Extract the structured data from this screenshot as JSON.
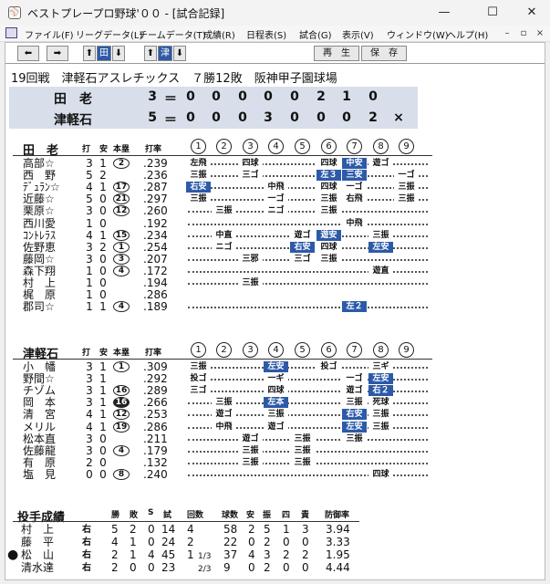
{
  "window": {
    "title": "ベストプレープロ野球'００ - [試合記録]",
    "app_icon": "⚾",
    "min": "—",
    "max": "☐",
    "close": "✕"
  },
  "menu": [
    "ファイル(F)",
    "リーグデータ(L)",
    "チームデータ(T)",
    "成績(R)",
    "日程表(S)",
    "試合(G)",
    "表示(V)",
    "ウィンドウ(W)",
    "ヘルプ(H)"
  ],
  "mdi_controls": [
    "–",
    "▫",
    "×"
  ],
  "toolbar": {
    "prev": "⬅",
    "next": "➡",
    "up": "⬆",
    "team1": "田",
    "down": "⬇",
    "team2": "津",
    "replay": "再　生",
    "save": "保　存"
  },
  "game_info": "19回戦　津軽石アスレチックス　７勝12敗　阪神甲子園球場",
  "linescore": [
    {
      "team": "田　老",
      "total": "3",
      "eq": "＝",
      "innings": [
        "0",
        "0",
        "0",
        "0",
        "0",
        "2",
        "1",
        "0",
        ""
      ]
    },
    {
      "team": "津軽石",
      "total": "5",
      "eq": "＝",
      "innings": [
        "0",
        "0",
        "0",
        "3",
        "0",
        "0",
        "0",
        "2",
        "×"
      ]
    }
  ],
  "inning_labels": [
    "1",
    "2",
    "3",
    "4",
    "5",
    "6",
    "7",
    "8",
    "9"
  ],
  "headers": {
    "ab": "打",
    "h": "安",
    "hr": "本塁",
    "avg": "打率"
  },
  "team1": {
    "name": "田　老",
    "players": [
      {
        "name": "高部☆",
        "ab": "3",
        "h": "1",
        "hr": "2",
        "hr_filled": false,
        "avg": ".239",
        "pa": [
          {
            "i": 1,
            "t": "左飛"
          },
          {
            "i": 3,
            "t": "四球"
          },
          {
            "i": 6,
            "t": "四球"
          },
          {
            "i": 7,
            "t": "中安",
            "hit": true
          },
          {
            "i": 8,
            "t": "遊ゴ"
          }
        ]
      },
      {
        "name": "西　野",
        "ab": "5",
        "h": "2",
        "hr": "",
        "avg": ".236",
        "pa": [
          {
            "i": 1,
            "t": "三振"
          },
          {
            "i": 3,
            "t": "三ゴ"
          },
          {
            "i": 6,
            "t": "左３",
            "hit": true
          },
          {
            "i": 7,
            "t": "三安",
            "hit": true
          },
          {
            "i": 9,
            "t": "一ゴ"
          }
        ]
      },
      {
        "name": "ﾃﾞｭﾗﾝ☆",
        "ab": "4",
        "h": "1",
        "hr": "17",
        "hr_filled": false,
        "avg": ".287",
        "pa": [
          {
            "i": 1,
            "t": "右安",
            "hit": true
          },
          {
            "i": 4,
            "t": "中飛"
          },
          {
            "i": 6,
            "t": "四球"
          },
          {
            "i": 7,
            "t": "一ゴ"
          },
          {
            "i": 9,
            "t": "三振"
          }
        ]
      },
      {
        "name": "近藤☆",
        "ab": "5",
        "h": "0",
        "hr": "21",
        "hr_filled": false,
        "avg": ".297",
        "pa": [
          {
            "i": 1,
            "t": "三振"
          },
          {
            "i": 4,
            "t": "一ゴ"
          },
          {
            "i": 6,
            "t": "三振"
          },
          {
            "i": 7,
            "t": "右飛"
          },
          {
            "i": 9,
            "t": "三振"
          }
        ]
      },
      {
        "name": "栗原☆",
        "ab": "3",
        "h": "0",
        "hr": "12",
        "hr_filled": false,
        "avg": ".260",
        "pa": [
          {
            "i": 2,
            "t": "三振"
          },
          {
            "i": 4,
            "t": "ニゴ"
          },
          {
            "i": 6,
            "t": "三振"
          }
        ]
      },
      {
        "name": "西川愛",
        "ab": "1",
        "h": "0",
        "hr": "",
        "avg": ".192",
        "pa": [
          {
            "i": 7,
            "t": "中飛"
          }
        ]
      },
      {
        "name": "ｺﾝﾄﾚﾗｽ",
        "ab": "4",
        "h": "1",
        "hr": "15",
        "hr_filled": false,
        "avg": ".234",
        "pa": [
          {
            "i": 2,
            "t": "中直"
          },
          {
            "i": 5,
            "t": "遊ゴ"
          },
          {
            "i": 6,
            "t": "遊安",
            "hit": true
          },
          {
            "i": 8,
            "t": "三振"
          }
        ]
      },
      {
        "name": "佐野恵",
        "ab": "3",
        "h": "2",
        "hr": "1",
        "hr_filled": false,
        "avg": ".254",
        "pa": [
          {
            "i": 2,
            "t": "ニゴ"
          },
          {
            "i": 5,
            "t": "右安",
            "hit": true
          },
          {
            "i": 6,
            "t": "四球"
          },
          {
            "i": 8,
            "t": "左安",
            "hit": true
          }
        ]
      },
      {
        "name": "藤岡☆",
        "ab": "3",
        "h": "0",
        "hr": "3",
        "hr_filled": false,
        "avg": ".207",
        "pa": [
          {
            "i": 3,
            "t": "三邪"
          },
          {
            "i": 5,
            "t": "三ゴ"
          },
          {
            "i": 6,
            "t": "三振"
          }
        ]
      },
      {
        "name": "森下翔",
        "ab": "1",
        "h": "0",
        "hr": "4",
        "hr_filled": false,
        "avg": ".172",
        "pa": [
          {
            "i": 8,
            "t": "遊直"
          }
        ]
      },
      {
        "name": "村　上",
        "ab": "1",
        "h": "0",
        "hr": "",
        "avg": ".194",
        "pa": [
          {
            "i": 3,
            "t": "三振"
          }
        ]
      },
      {
        "name": "梶　原",
        "ab": "1",
        "h": "0",
        "hr": "",
        "avg": ".286",
        "pa": []
      },
      {
        "name": "郡司☆",
        "ab": "1",
        "h": "1",
        "hr": "4",
        "hr_filled": false,
        "avg": ".189",
        "pa": [
          {
            "i": 7,
            "t": "左２",
            "hit": true
          }
        ]
      }
    ]
  },
  "team2": {
    "name": "津軽石",
    "players": [
      {
        "name": "小　幡",
        "ab": "3",
        "h": "1",
        "hr": "1",
        "hr_filled": false,
        "avg": ".309",
        "pa": [
          {
            "i": 1,
            "t": "三振"
          },
          {
            "i": 4,
            "t": "左安",
            "hit": true
          },
          {
            "i": 6,
            "t": "投ゴ"
          },
          {
            "i": 8,
            "t": "三ギ"
          }
        ]
      },
      {
        "name": "野間☆",
        "ab": "3",
        "h": "1",
        "hr": "",
        "avg": ".292",
        "pa": [
          {
            "i": 1,
            "t": "投ゴ"
          },
          {
            "i": 4,
            "t": "一ギ"
          },
          {
            "i": 7,
            "t": "一ゴ"
          },
          {
            "i": 8,
            "t": "左安",
            "hit": true
          }
        ]
      },
      {
        "name": "チゾム",
        "ab": "3",
        "h": "1",
        "hr": "16",
        "hr_filled": false,
        "avg": ".289",
        "pa": [
          {
            "i": 1,
            "t": "三ゴ"
          },
          {
            "i": 4,
            "t": "四球"
          },
          {
            "i": 7,
            "t": "遊ゴ"
          },
          {
            "i": 8,
            "t": "右２",
            "hit": true
          }
        ]
      },
      {
        "name": "岡　本",
        "ab": "3",
        "h": "1",
        "hr": "16",
        "hr_filled": true,
        "avg": ".266",
        "pa": [
          {
            "i": 2,
            "t": "三振"
          },
          {
            "i": 4,
            "t": "左本",
            "hit": true
          },
          {
            "i": 7,
            "t": "三振"
          },
          {
            "i": 8,
            "t": "死球"
          }
        ]
      },
      {
        "name": "清　宮",
        "ab": "4",
        "h": "1",
        "hr": "12",
        "hr_filled": false,
        "avg": ".253",
        "pa": [
          {
            "i": 2,
            "t": "遊ゴ"
          },
          {
            "i": 4,
            "t": "三振"
          },
          {
            "i": 7,
            "t": "右安",
            "hit": true
          },
          {
            "i": 8,
            "t": "三振"
          }
        ]
      },
      {
        "name": "メリル",
        "ab": "4",
        "h": "1",
        "hr": "19",
        "hr_filled": false,
        "avg": ".286",
        "pa": [
          {
            "i": 2,
            "t": "中飛"
          },
          {
            "i": 4,
            "t": "遊ゴ"
          },
          {
            "i": 7,
            "t": "左安",
            "hit": true
          },
          {
            "i": 8,
            "t": "三振"
          }
        ]
      },
      {
        "name": "松本直",
        "ab": "3",
        "h": "0",
        "hr": "",
        "avg": ".211",
        "pa": [
          {
            "i": 3,
            "t": "遊ゴ"
          },
          {
            "i": 5,
            "t": "三振"
          },
          {
            "i": 7,
            "t": "三振"
          }
        ]
      },
      {
        "name": "佐藤龍",
        "ab": "3",
        "h": "0",
        "hr": "4",
        "hr_filled": false,
        "avg": ".179",
        "pa": [
          {
            "i": 3,
            "t": "三振"
          },
          {
            "i": 5,
            "t": "三振"
          }
        ]
      },
      {
        "name": "有　原",
        "ab": "2",
        "h": "0",
        "hr": "",
        "avg": ".132",
        "pa": [
          {
            "i": 3,
            "t": "三振"
          },
          {
            "i": 5,
            "t": "三振"
          }
        ]
      },
      {
        "name": "塩　見",
        "ab": "0",
        "h": "0",
        "hr": "8",
        "hr_filled": false,
        "avg": ".240",
        "pa": [
          {
            "i": 8,
            "t": "四球"
          }
        ]
      }
    ]
  },
  "pitching": {
    "title": "投手成績",
    "headers": [
      "勝",
      "敗",
      "S",
      "試",
      "回数",
      "球数",
      "安",
      "振",
      "四",
      "責",
      "防御率"
    ],
    "rows": [
      {
        "mark": "",
        "name": "村　上",
        "hand": "右",
        "w": "5",
        "l": "2",
        "s": "0",
        "g": "14",
        "ip": "4",
        "frac": "",
        "np": "58",
        "h": "2",
        "k": "5",
        "bb": "1",
        "er": "3",
        "era": "3.94"
      },
      {
        "mark": "",
        "name": "藤　平",
        "hand": "右",
        "w": "4",
        "l": "1",
        "s": "0",
        "g": "24",
        "ip": "2",
        "frac": "",
        "np": "22",
        "h": "0",
        "k": "2",
        "bb": "0",
        "er": "0",
        "era": "3.33"
      },
      {
        "mark": "●",
        "name": "松　山",
        "hand": "右",
        "w": "2",
        "l": "1",
        "s": "4",
        "g": "45",
        "ip": "1",
        "frac": "1/3",
        "np": "37",
        "h": "4",
        "k": "3",
        "bb": "2",
        "er": "2",
        "era": "1.95"
      },
      {
        "mark": "",
        "name": "清水達",
        "hand": "右",
        "w": "2",
        "l": "0",
        "s": "0",
        "g": "23",
        "ip": "",
        "frac": "2/3",
        "np": "9",
        "h": "0",
        "k": "2",
        "bb": "0",
        "er": "0",
        "era": "4.44"
      }
    ]
  },
  "colors": {
    "hit": "#2d5aa8",
    "scorebox": "#d8dfea"
  }
}
